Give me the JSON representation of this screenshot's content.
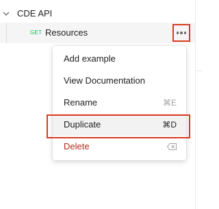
{
  "sidebar": {
    "collection": {
      "name": "CDE API"
    },
    "request": {
      "method": "GET",
      "name": "Resources"
    }
  },
  "context_menu": {
    "items": [
      {
        "label": "Add example",
        "shortcut": ""
      },
      {
        "label": "View Documentation",
        "shortcut": ""
      },
      {
        "label": "Rename",
        "shortcut": "⌘E"
      },
      {
        "label": "Duplicate",
        "shortcut": "⌘D"
      },
      {
        "label": "Delete",
        "shortcut": ""
      }
    ]
  },
  "colors": {
    "method_get": "#0cbb52",
    "highlight": "#d93a1e",
    "delete_text": "#b72c1c"
  },
  "icons": {
    "collection_toggle": "chevron-down-icon",
    "more_actions": "more-horizontal-icon",
    "delete_shortcut": "backspace-icon"
  }
}
